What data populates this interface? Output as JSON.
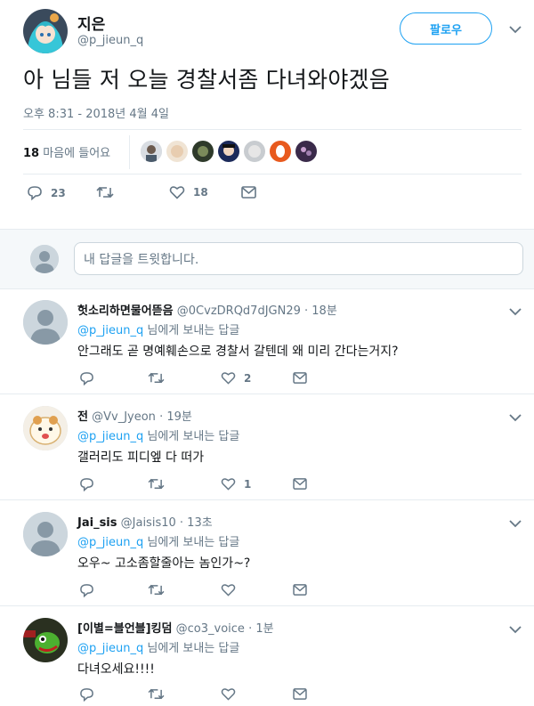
{
  "main_tweet": {
    "display_name": "지은",
    "handle": "@p_jieun_q",
    "follow_label": "팔로우",
    "text": "아 님들 저 오늘 경찰서좀 다녀와야겠음",
    "timestamp": "오후 8:31 - 2018년 4월 4일",
    "likes_count": "18",
    "likes_label": "마음에 들어요",
    "reply_count": "23",
    "retweet_count": "",
    "like_count": "18"
  },
  "reply_box": {
    "placeholder": "내 답글을 트윗합니다."
  },
  "colors": {
    "accent": "#1da1f2",
    "text": "#14171a",
    "muted": "#657786",
    "border": "#e6ecf0",
    "reply_bg": "#f5f8fa"
  },
  "icons": [
    "user-avatar-icon",
    "chevron-down-icon",
    "reply-icon",
    "retweet-icon",
    "heart-icon",
    "message-icon"
  ],
  "replies": [
    {
      "name": "헛소리하면물어뜯음",
      "handle": "@0CvzDRQd7dJGN29",
      "time": "18분",
      "to_handle": "@p_jieun_q",
      "to_suffix": "님에게 보내는 답글",
      "text": "안그래도 곧 명예훼손으로 경찰서 갈텐데 왜 미리 간다는거지?",
      "like_count": "2"
    },
    {
      "name": "전",
      "handle": "@Vv_Jyeon",
      "time": "19분",
      "to_handle": "@p_jieun_q",
      "to_suffix": "님에게 보내는 답글",
      "text": "갤러리도 피디엪 다 떠가",
      "like_count": "1"
    },
    {
      "name": "Jai_sis",
      "handle": "@Jaisis10",
      "time": "13초",
      "to_handle": "@p_jieun_q",
      "to_suffix": "님에게 보내는 답글",
      "text": "오우~ 고소좀할줄아는 놈인가~?",
      "like_count": ""
    },
    {
      "name": "[이별=블언블]킹덤",
      "handle": "@co3_voice",
      "time": "1분",
      "to_handle": "@p_jieun_q",
      "to_suffix": "님에게 보내는 답글",
      "text": "다녀오세요!!!!",
      "like_count": ""
    }
  ]
}
